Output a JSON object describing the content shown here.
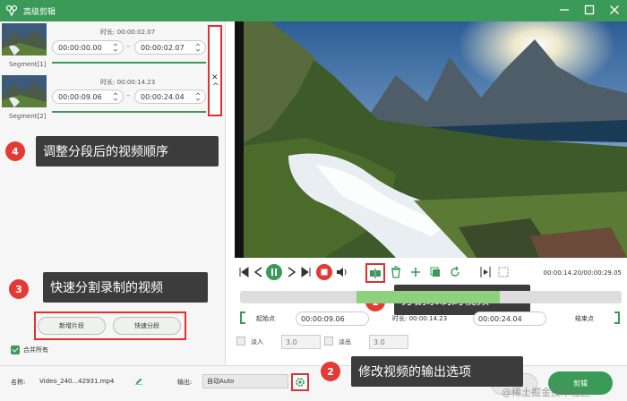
{
  "window": {
    "title": "高级剪辑"
  },
  "segments": [
    {
      "label": "Segment[1]",
      "duration_label": "时长: 00:00:02.07",
      "start": "00:00:00.00",
      "end": "00:00:02.07",
      "separator": "–",
      "progress": 1.0
    },
    {
      "label": "Segment[2]",
      "duration_label": "时长: 00:00:14.23",
      "start": "00:00:09.06",
      "end": "00:00:24.04",
      "separator": "–",
      "progress": 1.0
    }
  ],
  "reorder": {
    "close_glyph": "✕",
    "up_glyph": "^"
  },
  "annotations": [
    {
      "num": "4",
      "text": "调整分段后的视频顺序"
    },
    {
      "num": "3",
      "text": "快速分割录制的视频"
    },
    {
      "num": "1",
      "text": "分割录制的视频"
    },
    {
      "num": "2",
      "text": "修改视频的输出选项"
    }
  ],
  "buttons": {
    "new_segment": "新增片段",
    "quick_split": "快速分段",
    "merge_all": "合并所有",
    "clip": "剪辑"
  },
  "controls": {
    "time_readout": "00:00:14.20/00:00:29.05"
  },
  "range": {
    "start_label": "起始点",
    "start_value": "00:00:09.06",
    "duration_label": "时长: 00:00:14.23",
    "end_value": "00:00:24.04",
    "end_label": "结束点"
  },
  "fade": {
    "in_label": "淡入",
    "in_value": "3.0",
    "out_label": "淡出",
    "out_value": "3.0"
  },
  "output": {
    "name_label": "名称:",
    "name_value": "Video_240...42931.mp4",
    "output_label": "输出:",
    "output_value": "自动Auto"
  },
  "watermark": "@稀土掘金技术社区",
  "colors": {
    "accent": "#3b9a57",
    "highlight": "#e03030",
    "badge": "#e53935",
    "bubble": "#3c3c3c"
  }
}
